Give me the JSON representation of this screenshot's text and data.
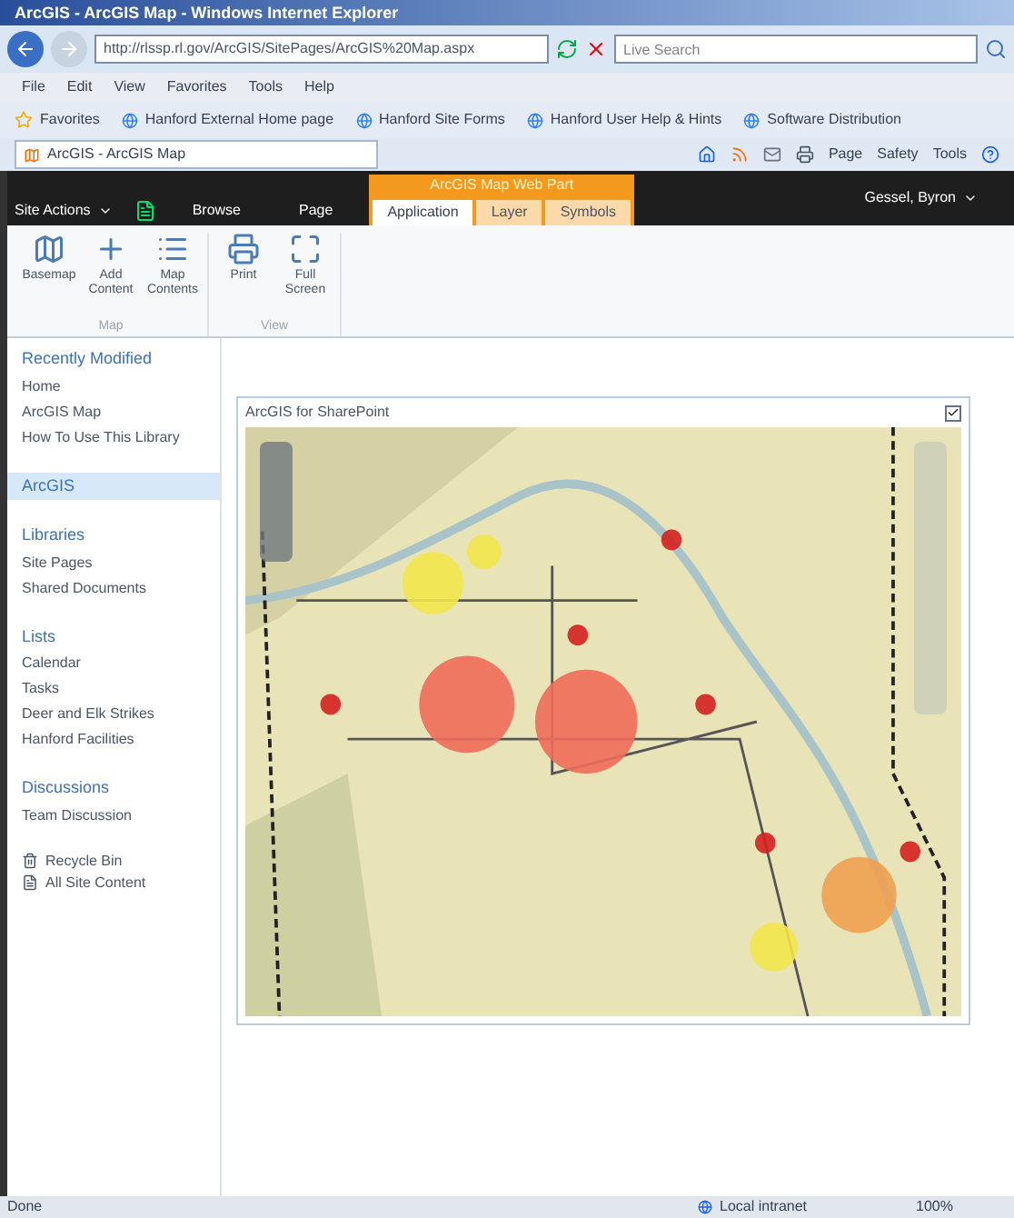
{
  "window": {
    "title": "ArcGIS - ArcGIS Map - Windows Internet Explorer"
  },
  "address_bar": {
    "url": "http://rlssp.rl.gov/ArcGIS/SitePages/ArcGIS%20Map.aspx",
    "search_placeholder": "Live Search"
  },
  "menu_bar": [
    "File",
    "Edit",
    "View",
    "Favorites",
    "Tools",
    "Help"
  ],
  "favorites_bar": {
    "label": "Favorites",
    "links": [
      "Hanford External Home page",
      "Hanford Site Forms",
      "Hanford User Help & Hints",
      "Software Distribution"
    ]
  },
  "browser_tab": {
    "title": "ArcGIS - ArcGIS Map"
  },
  "command_bar": [
    "Page",
    "Safety",
    "Tools"
  ],
  "sharepoint_bar": {
    "site_actions": "Site Actions",
    "tabs": [
      {
        "label": "Browse",
        "selected": false
      },
      {
        "label": "Page",
        "selected": false
      }
    ],
    "context_group": "ArcGIS Map Web Part",
    "context_tabs": [
      {
        "label": "Application",
        "selected": true
      },
      {
        "label": "Layer",
        "selected": false
      },
      {
        "label": "Symbols",
        "selected": false
      }
    ],
    "user": "Gessel, Byron"
  },
  "ribbon": {
    "groups": [
      {
        "label": "Map",
        "buttons": [
          {
            "kind": "basemap",
            "label": "Basemap"
          },
          {
            "kind": "add",
            "label": "Add Content"
          },
          {
            "kind": "contents",
            "label": "Map Contents"
          }
        ]
      },
      {
        "label": "View",
        "buttons": [
          {
            "kind": "print",
            "label": "Print"
          },
          {
            "kind": "fullscreen",
            "label": "Full Screen"
          }
        ]
      }
    ]
  },
  "sidebar": {
    "sections": [
      {
        "heading": "Recently Modified",
        "selected": false,
        "items": [
          "Home",
          "ArcGIS Map",
          "How To Use This Library"
        ]
      },
      {
        "heading": "ArcGIS",
        "selected": true
      },
      {
        "heading": "Libraries",
        "selected": false,
        "items": [
          "Site Pages",
          "Shared Documents"
        ]
      },
      {
        "heading": "Lists",
        "selected": false,
        "items": [
          "Calendar",
          "Tasks",
          "Deer and Elk Strikes",
          "Hanford Facilities"
        ]
      },
      {
        "heading": "Discussions",
        "selected": false,
        "items": [
          "Team Discussion"
        ]
      }
    ],
    "footer": [
      {
        "kind": "recycle",
        "label": "Recycle Bin"
      },
      {
        "kind": "content",
        "label": "All Site Content"
      }
    ]
  },
  "web_part": {
    "title": "ArcGIS for SharePoint",
    "checked": true
  },
  "status_bar": {
    "status": "Done",
    "zone": "Local intranet",
    "zoom": "100%"
  }
}
